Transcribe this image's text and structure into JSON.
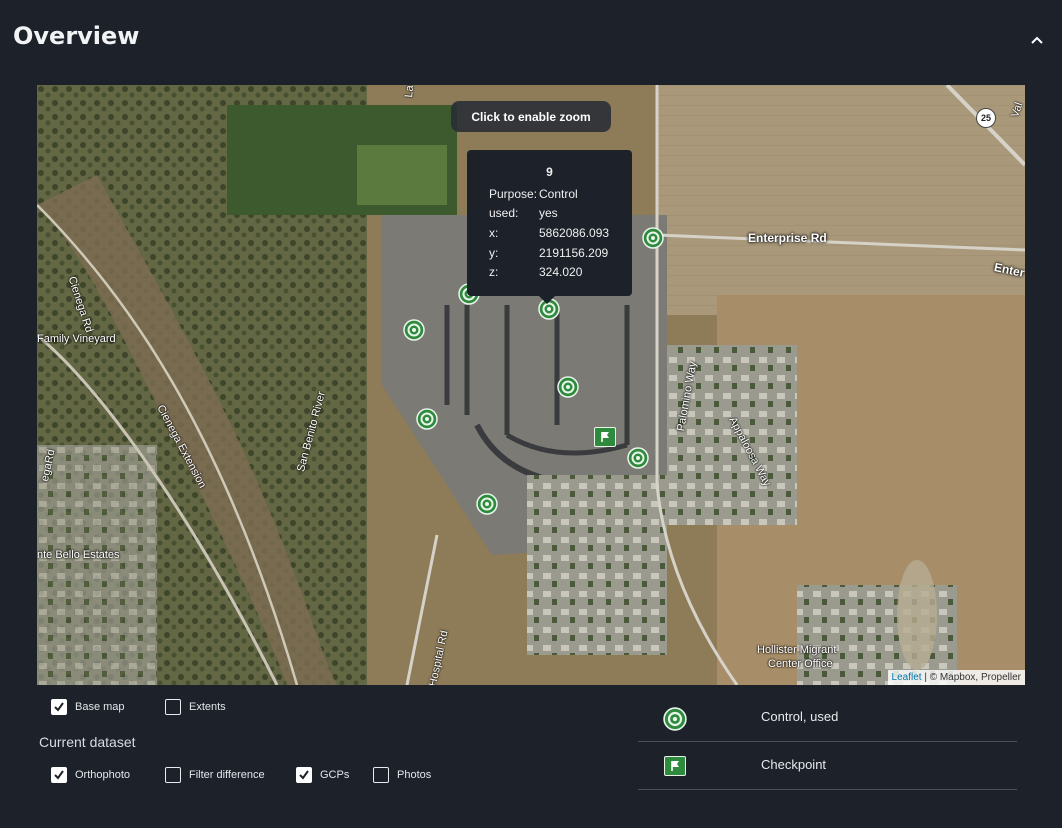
{
  "header": {
    "title": "Overview"
  },
  "map": {
    "zoom_hint": "Click to enable zoom",
    "popup": {
      "title": "9",
      "rows": [
        {
          "key": "Purpose:",
          "value": "Control"
        },
        {
          "key": "used:",
          "value": "yes"
        },
        {
          "key": "x:",
          "value": "5862086.093"
        },
        {
          "key": "y:",
          "value": "2191156.209"
        },
        {
          "key": "z:",
          "value": "324.020"
        }
      ]
    },
    "labels": {
      "enterprise_rd": "Enterprise Rd",
      "enterprise_rd_2": "Enter",
      "cienega_rd": "Cienega Rd",
      "family_vineyard": "Family Vineyard",
      "san_benito_river": "San Benito River",
      "cienega_extension": "Cienega Extension",
      "palomino_way": "Palomino Way",
      "appaloosa_way": "Appaloosa Way",
      "monte_bello": "nte Bello Estates",
      "hospital_rd": "Hospital Rd",
      "hollister_migrant": "Hollister Migrant",
      "center_office": "Center Office",
      "route_25": "25",
      "cienega_left": "egaRd",
      "la_rd": "La",
      "val": "Val"
    },
    "attribution": {
      "leaflet": "Leaflet",
      "rest": " | © Mapbox, Propeller"
    }
  },
  "layers": {
    "base_map": {
      "label": "Base map",
      "checked": true
    },
    "extents": {
      "label": "Extents",
      "checked": false
    }
  },
  "current_dataset": {
    "label": "Current dataset",
    "orthophoto": {
      "label": "Orthophoto",
      "checked": true
    },
    "filter_difference": {
      "label": "Filter difference",
      "checked": false
    },
    "gcps": {
      "label": "GCPs",
      "checked": true
    },
    "photos": {
      "label": "Photos",
      "checked": false
    }
  },
  "legend": [
    {
      "icon": "control-used-icon",
      "label": "Control, used"
    },
    {
      "icon": "checkpoint-flag-icon",
      "label": "Checkpoint"
    }
  ],
  "colors": {
    "background": "#1c212a",
    "marker": "#2e8b3e",
    "accent_link": "#0078a8"
  }
}
